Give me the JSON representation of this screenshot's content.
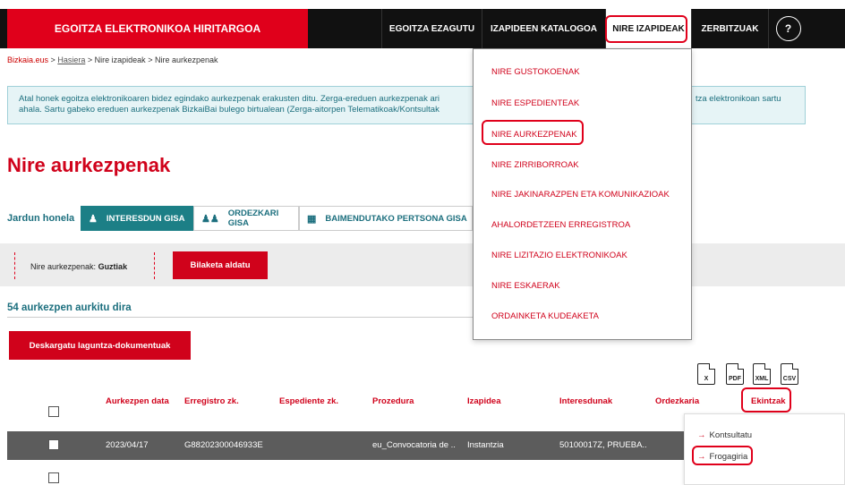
{
  "header": {
    "brand": "EGOITZA ELEKTRONIKOA HIRITARGOA",
    "nav": [
      {
        "label": "EGOITZA EZAGUTU"
      },
      {
        "label": "IZAPIDEEN KATALOGOA"
      },
      {
        "label": "NIRE IZAPIDEAK"
      },
      {
        "label": "ZERBITZUAK"
      }
    ],
    "help": "?"
  },
  "breadcrumb": {
    "site": "Bizkaia.eus",
    "sep": ">",
    "home": "Hasiera",
    "level2": "Nire izapideak",
    "current": "Nire aurkezpenak"
  },
  "info": {
    "line1": "Atal honek egoitza elektronikoaren bidez egindako aurkezpenak erakusten ditu. Zerga-ereduen aurkezpenak ari",
    "line1_end": "tza elektronikoan sartu",
    "line2": "ahala. Sartu gabeko ereduen aurkezpenak BizkaiBai bulego birtualean (Zerga-aitorpen Telematikoak/Kontsultak"
  },
  "page_title": "Nire aurkezpenak",
  "roles": {
    "label": "Jardun honela",
    "tabs": [
      {
        "label": "INTERESDUN GISA",
        "icon": "user-icon"
      },
      {
        "label": "ORDEZKARI GISA",
        "icon": "users-icon"
      },
      {
        "label": "BAIMENDUTAKO PERTSONA GISA",
        "icon": "id-card-icon"
      }
    ]
  },
  "filter": {
    "label": "Nire aurkezpenak:",
    "value": "Guztiak",
    "button": "Bilaketa aldatu"
  },
  "results": {
    "count_text": "54 aurkezpen aurkitu dira",
    "download_button": "Deskargatu laguntza-dokumentuak"
  },
  "exports": [
    "X",
    "PDF",
    "XML",
    "CSV"
  ],
  "table": {
    "headers": [
      "Aurkezpen data",
      "Erregistro zk.",
      "Espediente zk.",
      "Prozedura",
      "Izapidea",
      "Interesdunak",
      "Ordezkaria",
      "Ekintzak"
    ],
    "row": {
      "date": "2023/04/17",
      "registry": "G88202300046933E",
      "procedure": "eu_Convocatoria de ..",
      "step": "Instantzia",
      "interested": "50100017Z, PRUEBA.."
    }
  },
  "dropdown": [
    "NIRE GUSTOKOENAK",
    "NIRE ESPEDIENTEAK",
    "NIRE AURKEZPENAK",
    "NIRE ZIRRIBORROAK",
    "NIRE JAKINARAZPEN ETA KOMUNIKAZIOAK",
    "AHALORDETZEEN ERREGISTROA",
    "NIRE LIZITAZIO ELEKTRONIKOAK",
    "NIRE ESKAERAK",
    "ORDAINKETA KUDEAKETA"
  ],
  "actions": {
    "arrow": "→",
    "items": [
      "Kontsultatu",
      "Frogagiria"
    ]
  },
  "colors": {
    "brand_red": "#e0001b",
    "teal": "#1c7f86",
    "dark": "#111111"
  }
}
